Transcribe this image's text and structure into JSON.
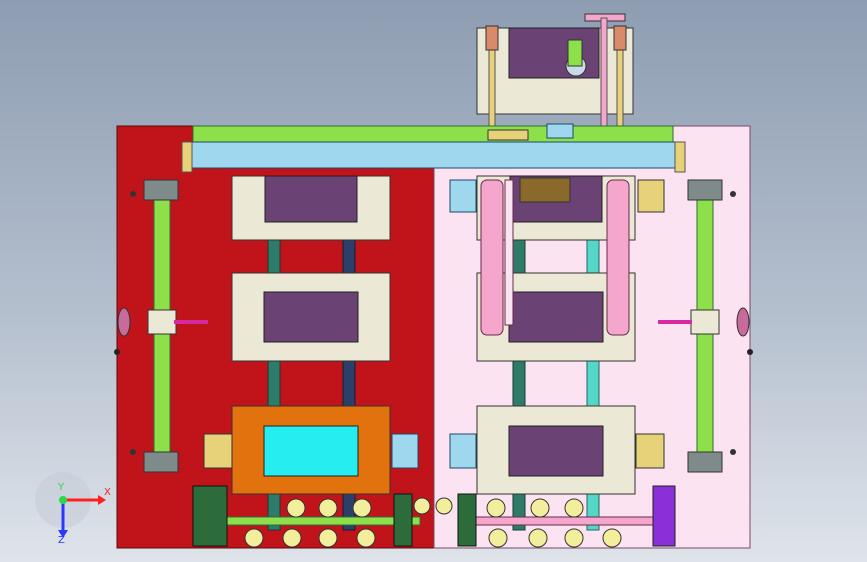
{
  "triad": {
    "x_label": "X",
    "y_label": "Y",
    "z_label": "Z"
  },
  "colors": {
    "left_plate": "#c0141a",
    "right_plate": "#fbe3f1",
    "panel": "#ece8d6",
    "window": "#6a4374",
    "window_highlight": "#26eef0",
    "orange_panel": "#e2720e",
    "rail_green": "#8ee04a",
    "rail_blue": "#9fd8ee",
    "rail_tan": "#e7d27a",
    "cylinder_pink": "#f4a6cc",
    "rod_teal": "#2e7b6a",
    "rod_navy": "#2c3f69",
    "rod_cyan": "#55d7c8",
    "magenta": "#d82aa0",
    "purple": "#8a30d8",
    "bearing_yellow": "#f3ee9c",
    "dark_green": "#2c6b3a"
  }
}
